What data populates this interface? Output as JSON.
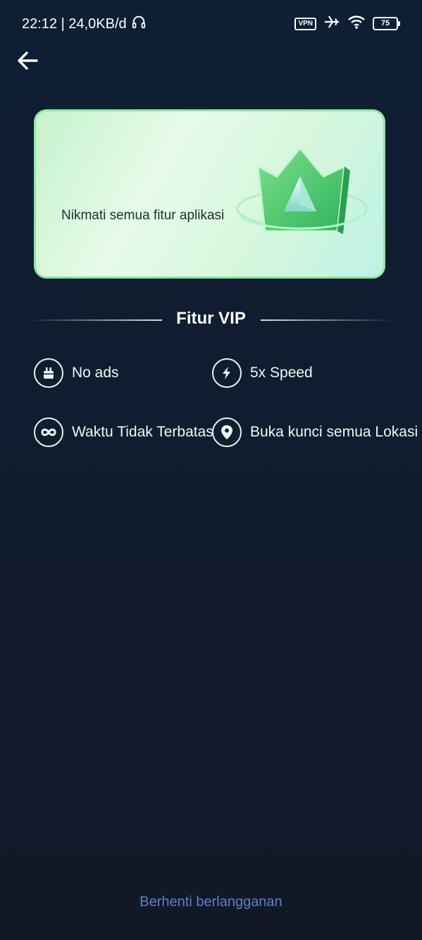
{
  "status_bar": {
    "time_speed": "22:12 | 24,0KB/d",
    "vpn_label": "VPN",
    "battery": "75"
  },
  "banner": {
    "text": "Nikmati semua fitur aplikasi"
  },
  "section": {
    "title": "Fitur VIP"
  },
  "features": [
    {
      "label": "No ads",
      "icon": "no-ads-icon"
    },
    {
      "label": "5x Speed",
      "icon": "lightning-icon"
    },
    {
      "label": "Waktu Tidak Terbatas",
      "icon": "infinity-icon"
    },
    {
      "label": "Buka kunci semua Lokasi",
      "icon": "location-pin-icon"
    }
  ],
  "footer": {
    "unsubscribe": "Berhenti berlangganan"
  },
  "colors": {
    "accent_green": "#8fe79a",
    "link_blue": "#5f7fc8",
    "background": "#111b2e"
  }
}
